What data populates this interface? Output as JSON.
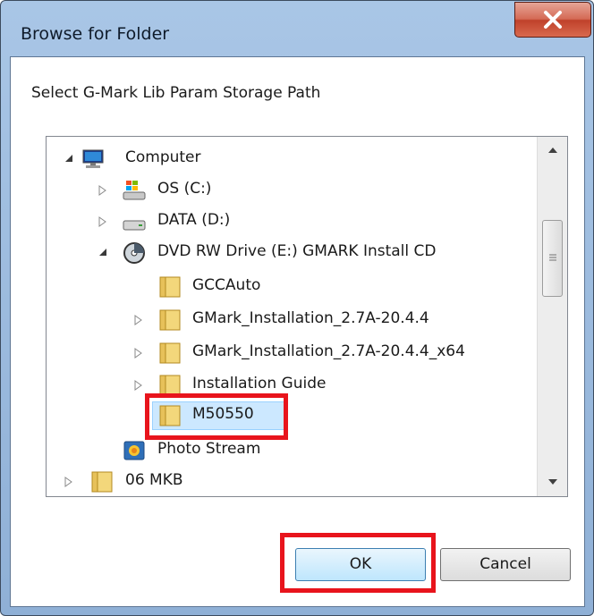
{
  "window": {
    "title": "Browse for Folder"
  },
  "dialog": {
    "prompt": "Select G-Mark Lib Param Storage Path"
  },
  "tree": {
    "items": [
      {
        "label": "Computer",
        "icon": "computer-icon",
        "expander": "expanded"
      },
      {
        "label": "OS (C:)",
        "icon": "windows-drive-icon",
        "expander": "collapsed"
      },
      {
        "label": "DATA (D:)",
        "icon": "hard-drive-icon",
        "expander": "collapsed"
      },
      {
        "label": "DVD RW Drive (E:) GMARK Install CD",
        "icon": "dvd-drive-icon",
        "expander": "expanded"
      },
      {
        "label": "GCCAuto",
        "icon": "folder-icon",
        "expander": "none"
      },
      {
        "label": "GMark_Installation_2.7A-20.4.4",
        "icon": "folder-icon",
        "expander": "collapsed"
      },
      {
        "label": "GMark_Installation_2.7A-20.4.4_x64",
        "icon": "folder-icon",
        "expander": "collapsed"
      },
      {
        "label": "Installation Guide",
        "icon": "folder-icon",
        "expander": "collapsed"
      },
      {
        "label": "M50550",
        "icon": "folder-icon",
        "expander": "none",
        "selected": true
      },
      {
        "label": "Photo Stream",
        "icon": "photo-stream-icon",
        "expander": "none"
      },
      {
        "label": "06 MKB",
        "icon": "folder-icon",
        "expander": "collapsed"
      }
    ]
  },
  "buttons": {
    "ok": "OK",
    "cancel": "Cancel"
  },
  "colors": {
    "callout": "#e8141c",
    "selection": "#cce8ff",
    "close_button": "#c0412a"
  }
}
